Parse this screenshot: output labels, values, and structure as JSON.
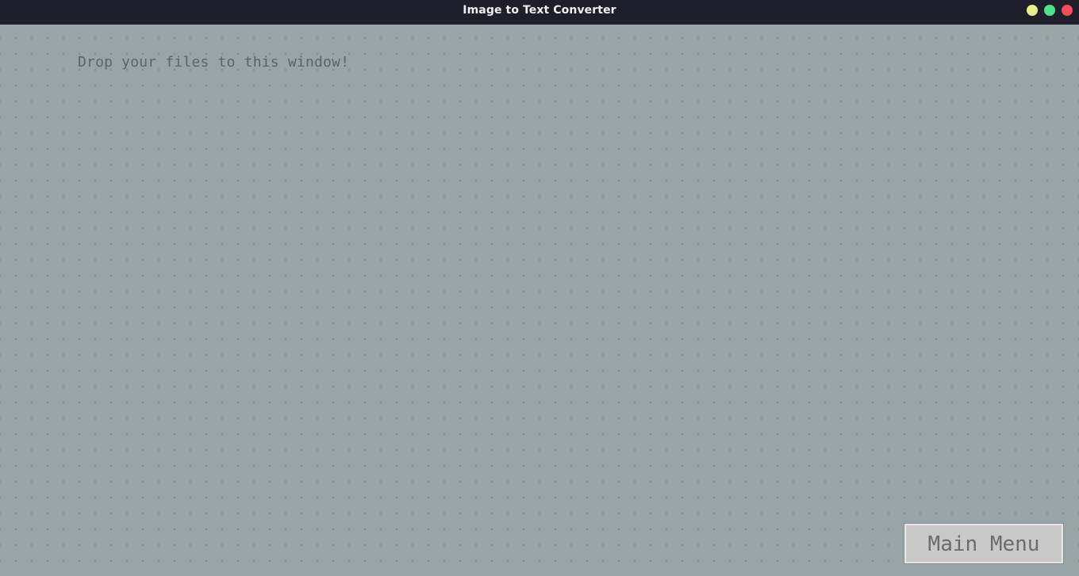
{
  "window": {
    "title": "Image to Text Converter",
    "controls": {
      "minimize_color": "#e9ee8a",
      "maximize_color": "#4fe08a",
      "close_color": "#f04e5b"
    }
  },
  "content": {
    "drop_message": "Drop your files to this window!",
    "main_menu_label": "Main Menu",
    "background_color": "#97a4a8"
  }
}
